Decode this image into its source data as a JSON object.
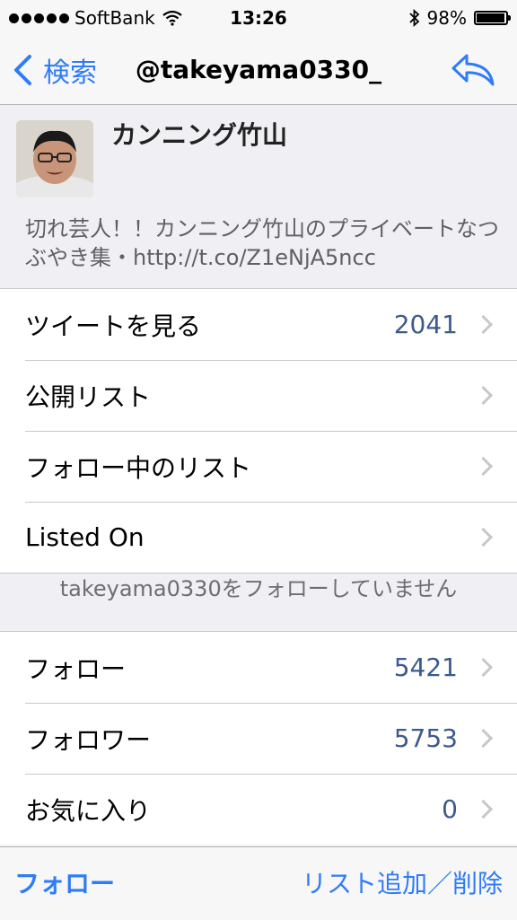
{
  "status": {
    "carrier": "SoftBank",
    "time": "13:26",
    "battery": "98%",
    "battery_level": 0.98
  },
  "nav": {
    "back_label": "検索",
    "title": "@takeyama0330_"
  },
  "profile": {
    "name": "カンニング竹山",
    "bio": "切れ芸人！！カンニング竹山のプライベートなつぶやき集・http://t.co/Z1eNjA5ncc"
  },
  "menu": {
    "tweets": {
      "label": "ツイートを見る",
      "value": "2041"
    },
    "public_lists": {
      "label": "公開リスト"
    },
    "following_lists": {
      "label": "フォロー中のリスト"
    },
    "listed_on": {
      "label": "Listed On"
    }
  },
  "follow_note": "takeyama0330をフォローしていません",
  "stats": {
    "following": {
      "label": "フォロー",
      "value": "5421"
    },
    "followers": {
      "label": "フォロワー",
      "value": "5753"
    },
    "favorites": {
      "label": "お気に入り",
      "value": "0"
    }
  },
  "toolbar": {
    "follow": "フォロー",
    "list_edit": "リスト追加／削除"
  },
  "colors": {
    "accent": "#2e7cf6",
    "value": "#3d5a8c",
    "background": "#efeff4"
  }
}
